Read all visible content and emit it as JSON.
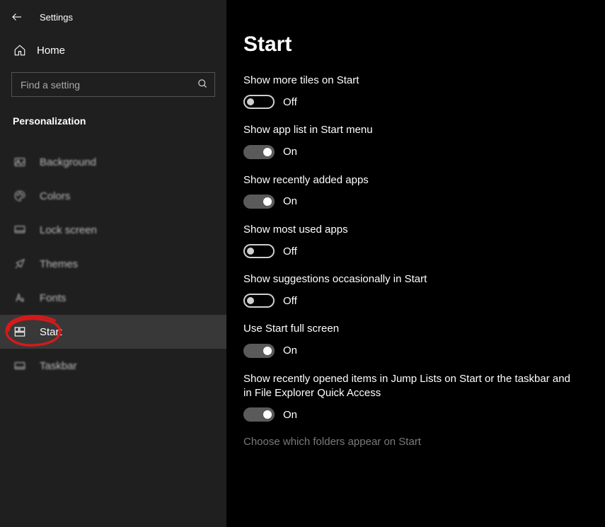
{
  "window": {
    "app_title": "Settings"
  },
  "sidebar": {
    "home_label": "Home",
    "search_placeholder": "Find a setting",
    "section_label": "Personalization",
    "items": [
      {
        "id": "background",
        "label": "Background",
        "selected": false
      },
      {
        "id": "colors",
        "label": "Colors",
        "selected": false
      },
      {
        "id": "lockscreen",
        "label": "Lock screen",
        "selected": false
      },
      {
        "id": "themes",
        "label": "Themes",
        "selected": false
      },
      {
        "id": "fonts",
        "label": "Fonts",
        "selected": false
      },
      {
        "id": "start",
        "label": "Start",
        "selected": true
      },
      {
        "id": "taskbar",
        "label": "Taskbar",
        "selected": false
      }
    ]
  },
  "main": {
    "title": "Start",
    "settings": [
      {
        "id": "more_tiles",
        "label": "Show more tiles on Start",
        "value": false,
        "state_text": "Off"
      },
      {
        "id": "app_list",
        "label": "Show app list in Start menu",
        "value": true,
        "state_text": "On"
      },
      {
        "id": "recently_added",
        "label": "Show recently added apps",
        "value": true,
        "state_text": "On"
      },
      {
        "id": "most_used",
        "label": "Show most used apps",
        "value": false,
        "state_text": "Off"
      },
      {
        "id": "suggestions",
        "label": "Show suggestions occasionally in Start",
        "value": false,
        "state_text": "Off"
      },
      {
        "id": "full_screen",
        "label": "Use Start full screen",
        "value": true,
        "state_text": "On"
      },
      {
        "id": "jump_lists",
        "label": "Show recently opened items in Jump Lists on Start or the taskbar and in File Explorer Quick Access",
        "value": true,
        "state_text": "On"
      }
    ],
    "link": "Choose which folders appear on Start"
  },
  "annotation": {
    "circled_item": "start"
  }
}
